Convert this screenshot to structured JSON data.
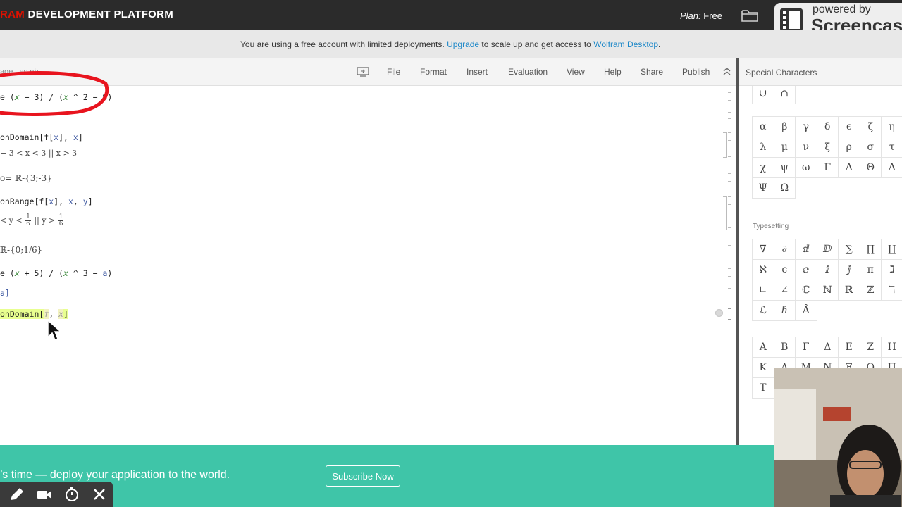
{
  "app": {
    "brand_partial_red": "RAM",
    "brand_rest": " DEVELOPMENT PLATFORM",
    "plan_label": "Plan:",
    "plan_value": "Free",
    "folder_icon": "folder-icon"
  },
  "watermark": {
    "top": "powered by",
    "bottom": "Screencas"
  },
  "notice": {
    "text_before": "You are using a free account with limited deployments. ",
    "upgrade_link": "Upgrade",
    "text_middle": " to scale up and get access to ",
    "desktop_link": "Wolfram Desktop",
    "text_after": ".",
    "link_color": "#1e88c8"
  },
  "toolbar": {
    "notebook_name": "age...es.nb",
    "menu": [
      "File",
      "Format",
      "Insert",
      "Evaluation",
      "View",
      "Help",
      "Share",
      "Publish"
    ]
  },
  "notebook": {
    "cells": {
      "c1": {
        "a": "e (",
        "x1": "x",
        "b": " − 3) / (",
        "x2": "x",
        "c": " ^ 2 − 9)"
      },
      "c2": {
        "a": "onDomain[f[",
        "b": "x",
        "c": "], ",
        "d": "x",
        "e": "]"
      },
      "c3": "− 3 < x < 3 || x > 3",
      "c4": "o= ℝ-{3;-3}",
      "c5": {
        "a": "onRange[f[",
        "b": "x",
        "c": "], ",
        "d": "x",
        "e": ", ",
        "f": "y",
        "g": "]"
      },
      "c6": {
        "a": "< y < ",
        "num1": "1",
        "den1": "6",
        "b": " || y > ",
        "num2": "1",
        "den2": "6"
      },
      "c7": "ℝ-{0;1/6}",
      "c8": {
        "a": "e (",
        "x1": "x",
        "b": " + 5) / (",
        "x2": "x",
        "c": " ^ 3 − ",
        "a2": "a",
        "d": ")"
      },
      "c9": "a]",
      "c10": {
        "a": "onDomain[",
        "p1": "f",
        "b": ", ",
        "p2": "x",
        "c": "]"
      }
    },
    "annotation_color": "#e8141e"
  },
  "panel": {
    "title": "Special Characters",
    "set_ops": [
      "∪",
      "∩"
    ],
    "greek_lower": [
      "α",
      "β",
      "γ",
      "δ",
      "ϵ",
      "ζ",
      "η",
      "λ",
      "μ",
      "ν",
      "ξ",
      "ρ",
      "σ",
      "τ",
      "χ",
      "ψ",
      "ω",
      "Γ",
      "Δ",
      "Θ",
      "Λ",
      "Ψ",
      "Ω"
    ],
    "typesetting_label": "Typesetting",
    "typesetting": [
      "∇",
      "∂",
      "ⅆ",
      "ⅅ",
      "∑",
      "∏",
      "∐",
      "ℵ",
      "ⅽ",
      "ⅇ",
      "ⅈ",
      "ⅉ",
      "π",
      "ℷ",
      "∟",
      "∠",
      "ℂ",
      "ℕ",
      "ℝ",
      "ℤ",
      "ℸ",
      "ℒ",
      "ℏ",
      "Å"
    ],
    "greek_upper": [
      "A",
      "B",
      "Γ",
      "Δ",
      "E",
      "Z",
      "H",
      "K",
      "Λ",
      "M",
      "N",
      "Ξ",
      "O",
      "Π",
      "T"
    ]
  },
  "promo": {
    "text": "’s time — deploy your application to the world.",
    "button": "Subscribe Now",
    "bg": "#3fc5a8"
  },
  "recorder": {
    "icons": [
      "pencil-icon",
      "camera-icon",
      "timer-icon",
      "close-icon"
    ]
  }
}
